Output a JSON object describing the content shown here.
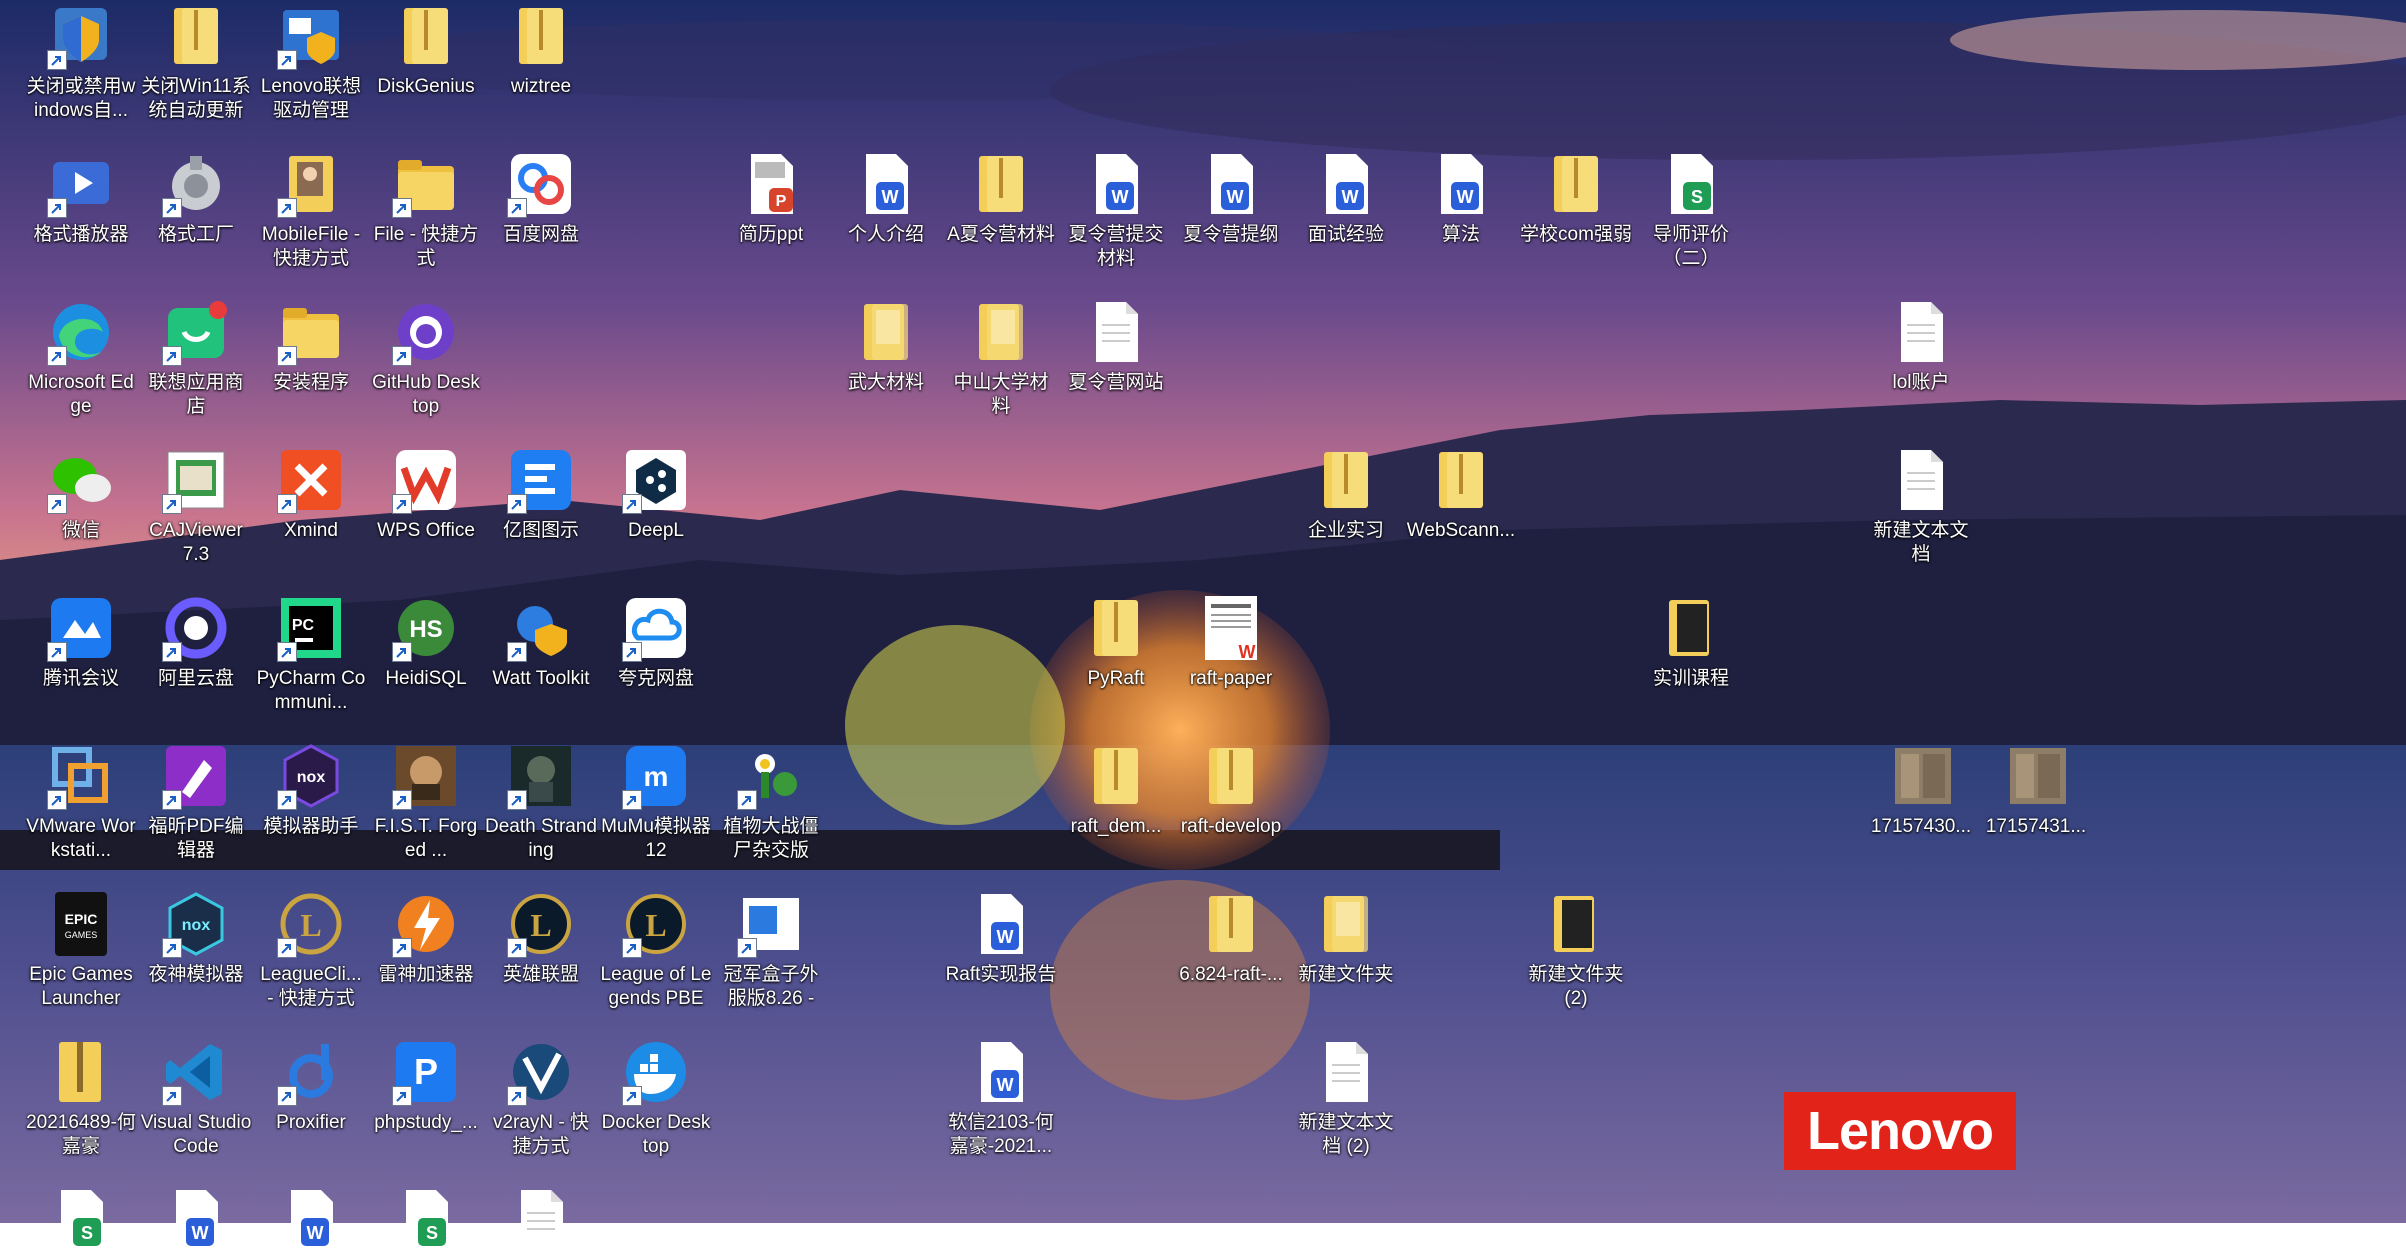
{
  "wallpaper": {
    "scene": "lake-dome-sunset"
  },
  "brand": {
    "logo_text": "Lenovo"
  },
  "icons": [
    {
      "label": "关闭或禁用windows自...",
      "icon": "shield-icon",
      "col": 0,
      "row": 0
    },
    {
      "label": "关闭Win11系统自动更新",
      "icon": "folder-zip-icon",
      "col": 1,
      "row": 0
    },
    {
      "label": "Lenovo联想驱动管理",
      "icon": "app-shield-icon",
      "col": 2,
      "row": 0
    },
    {
      "label": "DiskGenius",
      "icon": "folder-zip-icon",
      "col": 3,
      "row": 0
    },
    {
      "label": "wiztree",
      "icon": "folder-zip-icon",
      "col": 4,
      "row": 0
    },
    {
      "label": "格式播放器",
      "icon": "video-player-icon",
      "col": 0,
      "row": 1
    },
    {
      "label": "格式工厂",
      "icon": "format-factory-icon",
      "col": 1,
      "row": 1
    },
    {
      "label": "MobileFile - 快捷方式",
      "icon": "folder-photo-icon",
      "col": 2,
      "row": 1
    },
    {
      "label": "File - 快捷方式",
      "icon": "folder-icon",
      "col": 3,
      "row": 1
    },
    {
      "label": "百度网盘",
      "icon": "baidu-netdisk-icon",
      "col": 4,
      "row": 1
    },
    {
      "label": "简历ppt",
      "icon": "ppt-file-icon",
      "col": 6,
      "row": 1
    },
    {
      "label": "个人介绍",
      "icon": "word-file-icon",
      "col": 7,
      "row": 1
    },
    {
      "label": "A夏令营材料",
      "icon": "folder-zip-icon",
      "col": 8,
      "row": 1
    },
    {
      "label": "夏令营提交材料",
      "icon": "word-file-icon",
      "col": 9,
      "row": 1
    },
    {
      "label": "夏令营提纲",
      "icon": "word-file-icon",
      "col": 10,
      "row": 1
    },
    {
      "label": "面试经验",
      "icon": "word-file-icon",
      "col": 11,
      "row": 1
    },
    {
      "label": "算法",
      "icon": "word-file-icon",
      "col": 12,
      "row": 1
    },
    {
      "label": "学校com强弱",
      "icon": "folder-zip-icon",
      "col": 13,
      "row": 1
    },
    {
      "label": "导师评价（二）",
      "icon": "sheet-file-icon",
      "col": 14,
      "row": 1
    },
    {
      "label": "Microsoft Edge",
      "icon": "edge-icon",
      "col": 0,
      "row": 2
    },
    {
      "label": "联想应用商店",
      "icon": "lenovo-store-icon",
      "col": 1,
      "row": 2
    },
    {
      "label": "安装程序",
      "icon": "folder-icon",
      "col": 2,
      "row": 2
    },
    {
      "label": "GitHub Desktop",
      "icon": "github-icon",
      "col": 3,
      "row": 2
    },
    {
      "label": "武大材料",
      "icon": "folder-doc-icon",
      "col": 7,
      "row": 2
    },
    {
      "label": "中山大学材料",
      "icon": "folder-doc-icon",
      "col": 8,
      "row": 2
    },
    {
      "label": "夏令营网站",
      "icon": "text-file-icon",
      "col": 9,
      "row": 2
    },
    {
      "label": "lol账户",
      "icon": "text-file-icon",
      "col": 16,
      "row": 2
    },
    {
      "label": "微信",
      "icon": "wechat-icon",
      "col": 0,
      "row": 3
    },
    {
      "label": "CAJViewer 7.3",
      "icon": "cajviewer-icon",
      "col": 1,
      "row": 3
    },
    {
      "label": "Xmind",
      "icon": "xmind-icon",
      "col": 2,
      "row": 3
    },
    {
      "label": "WPS Office",
      "icon": "wps-icon",
      "col": 3,
      "row": 3
    },
    {
      "label": "亿图图示",
      "icon": "edraw-icon",
      "col": 4,
      "row": 3
    },
    {
      "label": "DeepL",
      "icon": "deepl-icon",
      "col": 5,
      "row": 3
    },
    {
      "label": "企业实习",
      "icon": "folder-zip-icon",
      "col": 11,
      "row": 3
    },
    {
      "label": "WebScann...",
      "icon": "folder-zip-icon",
      "col": 12,
      "row": 3
    },
    {
      "label": "新建文本文档",
      "icon": "text-file-icon",
      "col": 16,
      "row": 3
    },
    {
      "label": "腾讯会议",
      "icon": "tencent-meeting-icon",
      "col": 0,
      "row": 4
    },
    {
      "label": "阿里云盘",
      "icon": "aliyun-drive-icon",
      "col": 1,
      "row": 4
    },
    {
      "label": "PyCharm Communi...",
      "icon": "pycharm-icon",
      "col": 2,
      "row": 4
    },
    {
      "label": "HeidiSQL",
      "icon": "heidisql-icon",
      "col": 3,
      "row": 4
    },
    {
      "label": "Watt Toolkit",
      "icon": "watt-toolkit-icon",
      "col": 4,
      "row": 4
    },
    {
      "label": "夸克网盘",
      "icon": "quark-drive-icon",
      "col": 5,
      "row": 4
    },
    {
      "label": "PyRaft",
      "icon": "folder-zip-icon",
      "col": 9,
      "row": 4
    },
    {
      "label": "raft-paper",
      "icon": "pdf-file-icon",
      "col": 10,
      "row": 4
    },
    {
      "label": "实训课程",
      "icon": "folder-dark-icon",
      "col": 14,
      "row": 4
    },
    {
      "label": "VMware Workstati...",
      "icon": "vmware-icon",
      "col": 0,
      "row": 5
    },
    {
      "label": "福昕PDF编辑器",
      "icon": "foxit-icon",
      "col": 1,
      "row": 5
    },
    {
      "label": "模拟器助手",
      "icon": "nox-helper-icon",
      "col": 2,
      "row": 5
    },
    {
      "label": "F.I.S.T. Forged ...",
      "icon": "game-fist-icon",
      "col": 3,
      "row": 5
    },
    {
      "label": "Death Stranding",
      "icon": "game-death-stranding-icon",
      "col": 4,
      "row": 5
    },
    {
      "label": "MuMu模拟器12",
      "icon": "mumu-icon",
      "col": 5,
      "row": 5
    },
    {
      "label": "植物大战僵尸杂交版",
      "icon": "pvz-icon",
      "col": 6,
      "row": 5
    },
    {
      "label": "raft_dem...",
      "icon": "folder-zip-icon",
      "col": 9,
      "row": 5
    },
    {
      "label": "raft-develop",
      "icon": "folder-zip-icon",
      "col": 10,
      "row": 5
    },
    {
      "label": "17157430...",
      "icon": "image-file-icon",
      "col": 16,
      "row": 5
    },
    {
      "label": "17157431...",
      "icon": "image-file-icon",
      "col": 17,
      "row": 5
    },
    {
      "label": "Epic Games Launcher",
      "icon": "epic-games-icon",
      "col": 0,
      "row": 6
    },
    {
      "label": "夜神模拟器",
      "icon": "nox-icon",
      "col": 1,
      "row": 6
    },
    {
      "label": "LeagueCli... - 快捷方式",
      "icon": "league-client-icon",
      "col": 2,
      "row": 6
    },
    {
      "label": "雷神加速器",
      "icon": "leishen-icon",
      "col": 3,
      "row": 6
    },
    {
      "label": "英雄联盟",
      "icon": "league-icon",
      "col": 4,
      "row": 6
    },
    {
      "label": "League of Legends PBE",
      "icon": "league-icon",
      "col": 5,
      "row": 6
    },
    {
      "label": "冠军盒子外服版8.26 - 快...",
      "icon": "champion-box-icon",
      "col": 6,
      "row": 6
    },
    {
      "label": "Raft实现报告",
      "icon": "word-file-icon",
      "col": 8,
      "row": 6
    },
    {
      "label": "6.824-raft-...",
      "icon": "folder-zip-icon",
      "col": 10,
      "row": 6
    },
    {
      "label": "新建文件夹",
      "icon": "folder-doc-icon",
      "col": 11,
      "row": 6
    },
    {
      "label": "新建文件夹 (2)",
      "icon": "folder-dark-icon",
      "col": 13,
      "row": 6
    },
    {
      "label": "20216489-何嘉豪",
      "icon": "zip-folder-icon",
      "col": 0,
      "row": 7
    },
    {
      "label": "Visual Studio Code",
      "icon": "vscode-icon",
      "col": 1,
      "row": 7
    },
    {
      "label": "Proxifier",
      "icon": "proxifier-icon",
      "col": 2,
      "row": 7
    },
    {
      "label": "phpstudy_...",
      "icon": "phpstudy-icon",
      "col": 3,
      "row": 7
    },
    {
      "label": "v2rayN - 快捷方式",
      "icon": "v2rayn-icon",
      "col": 4,
      "row": 7
    },
    {
      "label": "Docker Desktop",
      "icon": "docker-icon",
      "col": 5,
      "row": 7
    },
    {
      "label": "软信2103-何嘉豪-2021...",
      "icon": "word-file-icon",
      "col": 8,
      "row": 7
    },
    {
      "label": "新建文本文档 (2)",
      "icon": "text-file-icon",
      "col": 11,
      "row": 7
    },
    {
      "label": "",
      "icon": "sheet-file-icon",
      "col": 0,
      "row": 8
    },
    {
      "label": "",
      "icon": "word-file-icon",
      "col": 1,
      "row": 8
    },
    {
      "label": "",
      "icon": "word-file-icon",
      "col": 2,
      "row": 8
    },
    {
      "label": "",
      "icon": "sheet-file-icon",
      "col": 3,
      "row": 8
    },
    {
      "label": "",
      "icon": "text-file-icon",
      "col": 4,
      "row": 8
    }
  ]
}
